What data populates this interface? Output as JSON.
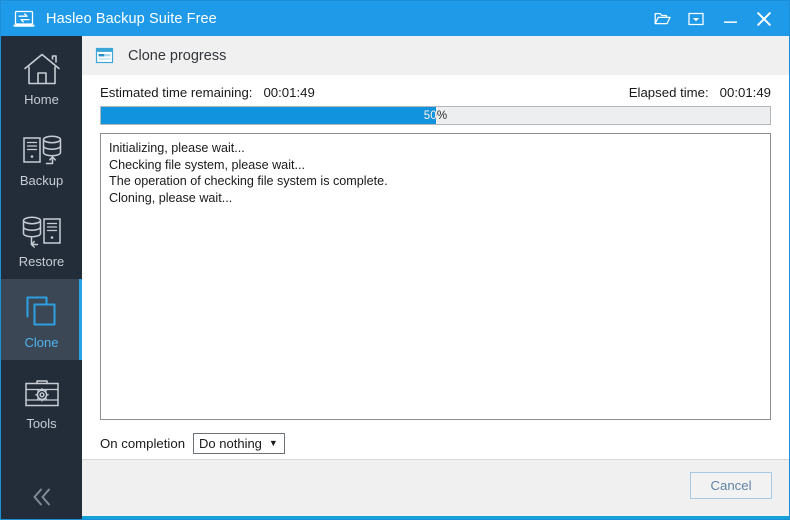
{
  "window": {
    "title": "Hasleo Backup Suite Free",
    "logo_icon": "laptop-transfer-icon",
    "controls": [
      {
        "name": "open-folder-icon",
        "label": "Open"
      },
      {
        "name": "menu-dropdown-icon",
        "label": "Menu"
      },
      {
        "name": "minimize-icon",
        "label": "Minimize"
      },
      {
        "name": "close-icon",
        "label": "Close"
      }
    ]
  },
  "sidebar": {
    "items": [
      {
        "label": "Home",
        "icon": "home-icon",
        "selected": false
      },
      {
        "label": "Backup",
        "icon": "backup-icon",
        "selected": false
      },
      {
        "label": "Restore",
        "icon": "restore-icon",
        "selected": false
      },
      {
        "label": "Clone",
        "icon": "clone-icon",
        "selected": true
      },
      {
        "label": "Tools",
        "icon": "tools-icon",
        "selected": false
      }
    ],
    "collapse_icon": "chevron-double-left-icon",
    "selected_color": "#4fb4ee",
    "accent_color": "#29a3e8"
  },
  "page": {
    "header_icon": "progress-window-icon",
    "title": "Clone progress",
    "estimated": {
      "label": "Estimated time remaining:",
      "value": "00:01:49"
    },
    "elapsed": {
      "label": "Elapsed time:",
      "value": "00:01:49"
    },
    "progress": {
      "percent": 50,
      "text": "50%",
      "fill_color": "#1293de",
      "track_color": "#eceef0"
    },
    "log": [
      "Initializing, please wait...",
      "Checking file system, please wait...",
      "The operation of checking file system is complete.",
      "Cloning, please wait..."
    ],
    "on_completion": {
      "label": "On completion",
      "value": "Do nothing",
      "caret": "▼"
    }
  },
  "footer": {
    "cancel_label": "Cancel"
  }
}
